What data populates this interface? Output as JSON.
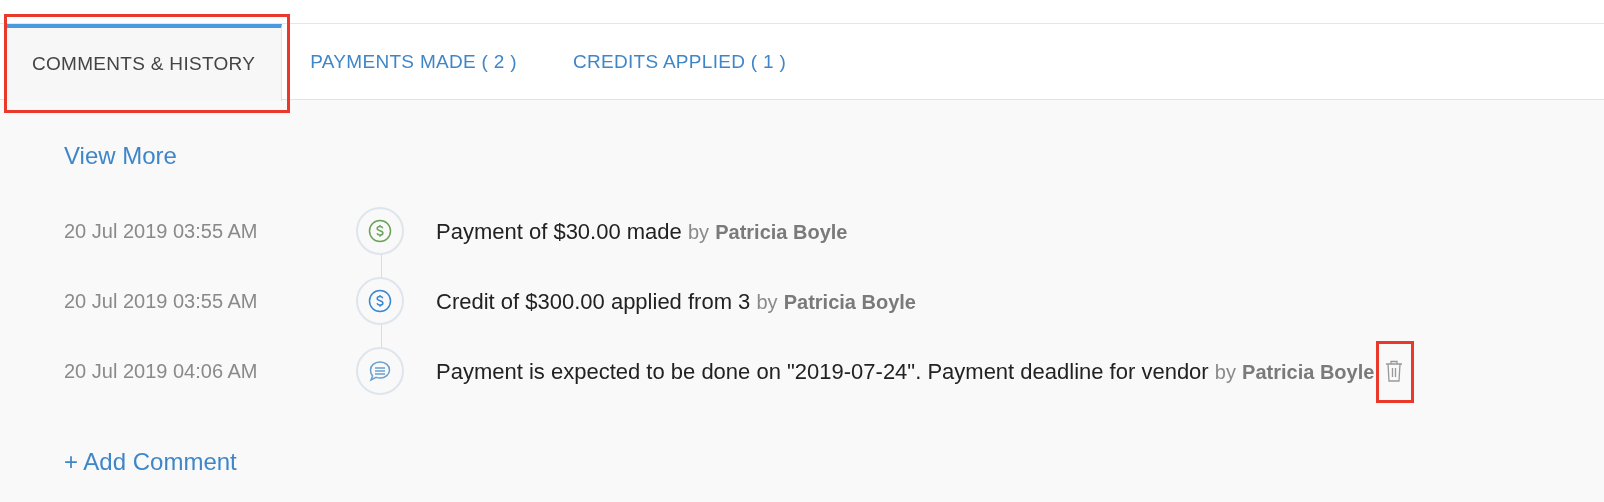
{
  "tabs": [
    {
      "label": "COMMENTS & HISTORY",
      "selected": true,
      "highlighted": true
    },
    {
      "label": "PAYMENTS MADE ( 2 )",
      "selected": false,
      "highlighted": false
    },
    {
      "label": "CREDITS APPLIED ( 1 )",
      "selected": false,
      "highlighted": false
    }
  ],
  "view_more": "View More",
  "history": [
    {
      "time": "20 Jul 2019 03:55 AM",
      "kind": "payment",
      "text": "Payment of $30.00 made",
      "by": "by",
      "author": "Patricia Boyle",
      "deletable": false
    },
    {
      "time": "20 Jul 2019 03:55 AM",
      "kind": "credit",
      "text": "Credit of $300.00 applied from 3",
      "by": "by",
      "author": "Patricia Boyle",
      "deletable": false
    },
    {
      "time": "20 Jul 2019 04:06 AM",
      "kind": "comment",
      "text": "Payment is expected to be done on \"2019-07-24\". Payment deadline for vendor",
      "by": "by",
      "author": "Patricia Boyle",
      "deletable": true,
      "highlighted": true
    }
  ],
  "add_comment": "+ Add Comment"
}
